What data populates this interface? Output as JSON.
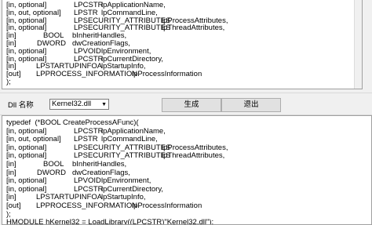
{
  "top_code": [
    {
      "prefix": "[in, optional]",
      "type": "LPCSTR",
      "name": "lpApplicationName,"
    },
    {
      "prefix": "[in, out, optional]",
      "type": "LPSTR",
      "name": "lpCommandLine,"
    },
    {
      "prefix": "[in, optional]",
      "type": "LPSECURITY_ATTRIBUTES",
      "name": "lpProcessAttributes,"
    },
    {
      "prefix": "[in, optional]",
      "type": "LPSECURITY_ATTRIBUTES",
      "name": "lpThreadAttributes,"
    },
    {
      "prefix": "[in]",
      "type": "BOOL",
      "name": "bInheritHandles,"
    },
    {
      "prefix": "[in]",
      "type": "DWORD",
      "name": "dwCreationFlags,"
    },
    {
      "prefix": "[in, optional]",
      "type": "LPVOID",
      "name": "lpEnvironment,"
    },
    {
      "prefix": "[in, optional]",
      "type": "LPCSTR",
      "name": "lpCurrentDirectory,"
    },
    {
      "prefix": "[in]",
      "type": "LPSTARTUPINFOA",
      "name": "lpStartupInfo,"
    },
    {
      "prefix": "[out]",
      "type": "LPPROCESS_INFORMATION",
      "name": "lpProcessInformation"
    },
    {
      "prefix": ");",
      "type": "",
      "name": ""
    }
  ],
  "controls": {
    "dll_label": "Dll 名称",
    "dll_value": "Kernel32.dll",
    "generate_label": "生成",
    "exit_label": "退出"
  },
  "bottom_code": [
    {
      "prefix": "typedef  (*BOOL CreateProcessAFunc)(",
      "type": "",
      "name": ""
    },
    {
      "prefix": "[in, optional]",
      "type": "LPCSTR",
      "name": "lpApplicationName,"
    },
    {
      "prefix": "[in, out, optional]",
      "type": "LPSTR",
      "name": "lpCommandLine,"
    },
    {
      "prefix": "[in, optional]",
      "type": "LPSECURITY_ATTRIBUTES",
      "name": "lpProcessAttributes,"
    },
    {
      "prefix": "[in, optional]",
      "type": "LPSECURITY_ATTRIBUTES",
      "name": "lpThreadAttributes,"
    },
    {
      "prefix": "[in]",
      "type": "BOOL",
      "name": "bInheritHandles,"
    },
    {
      "prefix": "[in]",
      "type": "DWORD",
      "name": "dwCreationFlags,"
    },
    {
      "prefix": "[in, optional]",
      "type": "LPVOID",
      "name": "lpEnvironment,"
    },
    {
      "prefix": "[in, optional]",
      "type": "LPCSTR",
      "name": "lpCurrentDirectory,"
    },
    {
      "prefix": "[in]",
      "type": "LPSTARTUPINFOA",
      "name": "lpStartupInfo,"
    },
    {
      "prefix": "[out]",
      "type": "LPPROCESS_INFORMATION",
      "name": "lpProcessInformation"
    },
    {
      "prefix": ");",
      "type": "",
      "name": ""
    },
    {
      "prefix": "HMODULE hKernel32 = LoadLibrary((LPCSTR)\"Kernel32.dll\");",
      "type": "",
      "name": ""
    }
  ]
}
